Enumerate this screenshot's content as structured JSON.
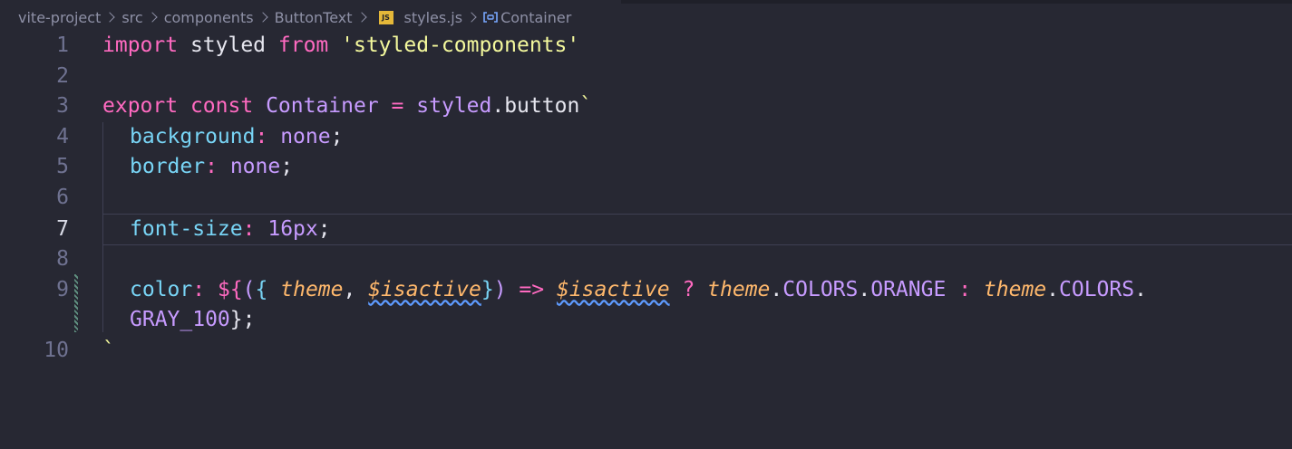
{
  "breadcrumb": {
    "items": [
      "vite-project",
      "src",
      "components",
      "ButtonText"
    ],
    "file_icon": "JS",
    "file": "styles.js",
    "symbol_icon": "symbol-variable-icon",
    "symbol": "Container"
  },
  "active_line": 7,
  "lines": [
    {
      "n": "1"
    },
    {
      "n": "2"
    },
    {
      "n": "3"
    },
    {
      "n": "4"
    },
    {
      "n": "5"
    },
    {
      "n": "6"
    },
    {
      "n": "7"
    },
    {
      "n": "8"
    },
    {
      "n": "9"
    },
    {
      "n": "10"
    }
  ],
  "tokens": {
    "l1": [
      "import",
      " styled ",
      "from",
      " ",
      "'styled-components'"
    ],
    "l3": [
      "export",
      " ",
      "const",
      " ",
      "Container",
      " ",
      "=",
      " ",
      "styled",
      ".button",
      "`"
    ],
    "l4": [
      "background",
      ":",
      " ",
      "none",
      ";"
    ],
    "l5": [
      "border",
      ":",
      " ",
      "none",
      ";"
    ],
    "l7": [
      "font-size",
      ":",
      " ",
      "16px",
      ";"
    ],
    "l9": [
      "color",
      ":",
      " ",
      "${",
      "(",
      "{",
      " ",
      "theme",
      ", ",
      "$isactive",
      "}",
      ")",
      " ",
      "=>",
      " ",
      "$isactive",
      " ",
      "?",
      " ",
      "theme",
      ".",
      "COLORS",
      ".",
      "ORANGE",
      " ",
      ":",
      " ",
      "theme",
      ".",
      "COLORS",
      "."
    ],
    "l9b": [
      "GRAY_100",
      "};"
    ],
    "l10": [
      "`"
    ]
  },
  "colors": {
    "background": "#272833",
    "keyword": "#ff6ac1",
    "string": "#f4f99d",
    "type": "#c79bff",
    "property": "#78d4f5",
    "parameter": "#ffb86c"
  }
}
